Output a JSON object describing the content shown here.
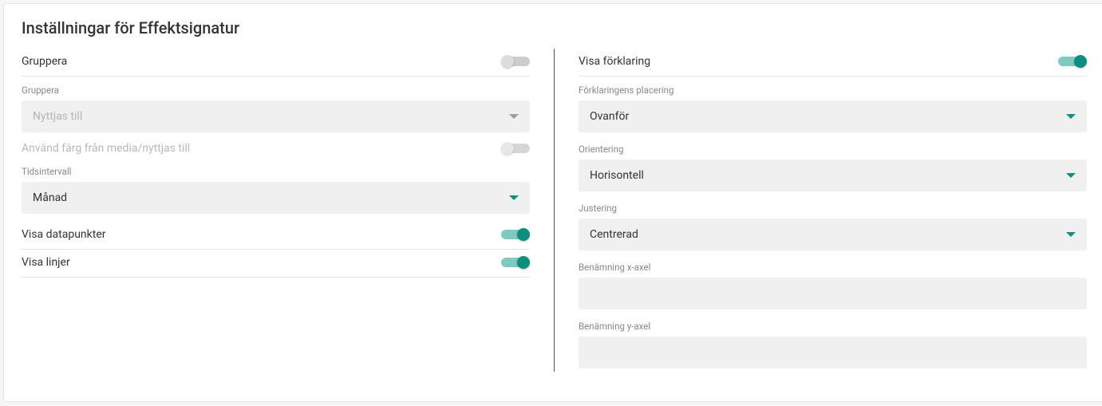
{
  "title": "Inställningar för Effektsignatur",
  "left": {
    "group": {
      "label": "Gruppera",
      "on": false,
      "field_label": "Gruppera",
      "value": "Nyttjas till"
    },
    "use_color": {
      "label": "Använd färg från media/nyttjas till",
      "on": false,
      "enabled": false
    },
    "interval": {
      "field_label": "Tidsintervall",
      "value": "Månad"
    },
    "datapoints": {
      "label": "Visa datapunkter",
      "on": true
    },
    "lines": {
      "label": "Visa linjer",
      "on": true
    }
  },
  "right": {
    "legend": {
      "label": "Visa förklaring",
      "on": true
    },
    "placement": {
      "field_label": "Förklaringens placering",
      "value": "Ovanför"
    },
    "orientation": {
      "field_label": "Orientering",
      "value": "Horisontell"
    },
    "align": {
      "field_label": "Justering",
      "value": "Centrerad"
    },
    "xlabel": {
      "field_label": "Benämning x-axel",
      "value": ""
    },
    "ylabel": {
      "field_label": "Benämning y-axel",
      "value": ""
    }
  },
  "colors": {
    "accent": "#0d8f7f"
  }
}
